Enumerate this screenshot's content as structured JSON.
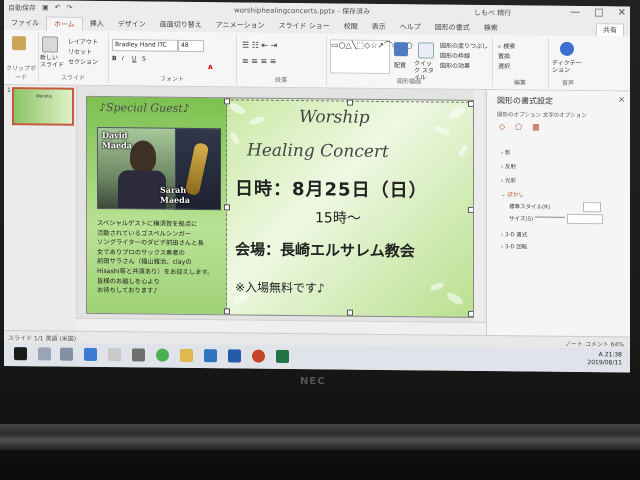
{
  "window": {
    "autosave": "自動保存",
    "title": "worshiphealingconcerts.pptx - 保存済み",
    "user": "しもべ 精行",
    "controls": [
      "—",
      "□",
      "✕"
    ]
  },
  "tabs": [
    "ファイル",
    "ホーム",
    "挿入",
    "デザイン",
    "画面切り替え",
    "アニメーション",
    "スライド ショー",
    "校閲",
    "表示",
    "ヘルプ",
    "図形の書式",
    "検索"
  ],
  "share": "共有",
  "ribbon": {
    "clipboard": "クリップボード",
    "slide": "スライド",
    "font": "フォント",
    "paragraph": "段落",
    "drawing": "図形描画",
    "edit": "編集",
    "voice": "音声",
    "new_slide": "新しい スライド",
    "layout": "レイアウト",
    "reset": "リセット",
    "section": "セクション",
    "font_name": "Bradley Hand ITC",
    "font_size": "48",
    "arrange": "配置",
    "quick_style": "クイック スタイル",
    "shape_fill": "図形の塗りつぶし",
    "shape_outline": "図形の枠線",
    "shape_effect": "図形の効果",
    "find": "検索",
    "replace": "置換",
    "select": "選択",
    "dictate": "ディクテー ション"
  },
  "thumbnail": {
    "number": "1"
  },
  "slide": {
    "guest_heading": "♪Special Guest♪",
    "name1": "David\nMaeda",
    "name2": "Sarah\nMaeda",
    "guest_lines": [
      "スペシャルゲストに横須賀を拠点に",
      "活動されているゴスペルシンガー",
      "ソングライターのダビデ前田さんと長",
      "女でありプロのサックス奏者の",
      "前田サラさん（福山雅治、clayの",
      "Hisashi等と共演あり）をお迎えします。",
      "皆様のお越しを心より",
      "お待ちしております♪"
    ],
    "title1": "Worship",
    "title2": "Healing Concert",
    "date": "日時：8月25日（日）",
    "time": "15時～",
    "venue": "会場：長崎エルサレム教会",
    "free": "※入場無料です♪"
  },
  "pane": {
    "title": "図形の書式設定",
    "close": "✕",
    "sub": "図形のオプション   文字のオプション",
    "items": [
      "影",
      "反射",
      "光彩",
      "ぼかし",
      "標準スタイル(R)",
      "サイズ(S)",
      "3-D 書式",
      "3-D 回転"
    ]
  },
  "status": {
    "left": "スライド 1/1   英語 (米国)",
    "right": "ノート   コメント   64%"
  },
  "tray": {
    "time": "21:38",
    "date": "2019/08/11",
    "ime": "A"
  },
  "bezel_brand": "NEC",
  "colors": {
    "accent": "#b7472a",
    "slide_green": "#7cc04f"
  }
}
